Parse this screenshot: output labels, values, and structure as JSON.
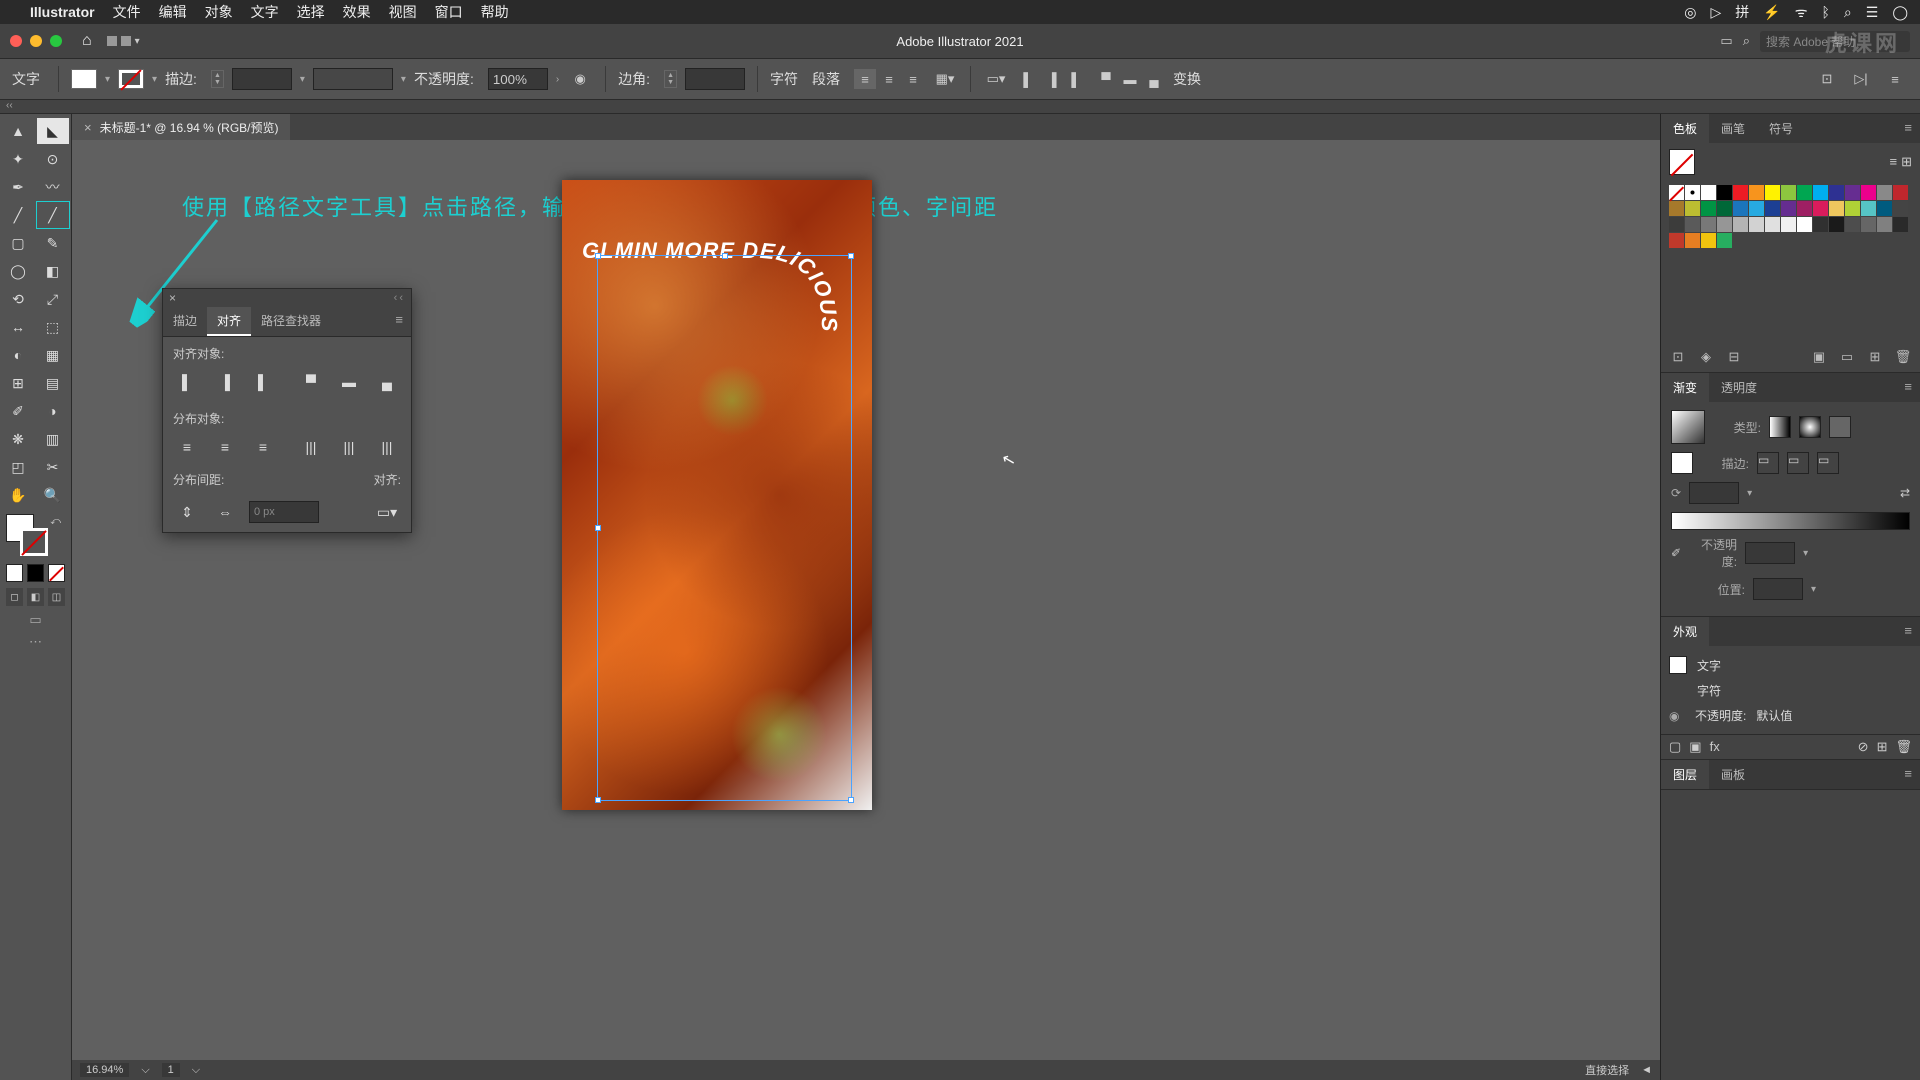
{
  "macos": {
    "app_name": "Illustrator",
    "menus": [
      "文件",
      "编辑",
      "对象",
      "文字",
      "选择",
      "效果",
      "视图",
      "窗口",
      "帮助"
    ]
  },
  "titlebar": {
    "title": "Adobe Illustrator 2021",
    "search_placeholder": "搜索 Adobe 帮助"
  },
  "controlbar": {
    "mode_label": "文字",
    "stroke_label": "描边:",
    "opacity_label": "不透明度:",
    "opacity_value": "100%",
    "corner_label": "边角:",
    "char_label": "字符",
    "para_label": "段落",
    "transform_label": "变换"
  },
  "document": {
    "tab_name": "未标题-1* @ 16.94 % (RGB/预览)",
    "zoom": "16.94%",
    "page": "1",
    "status": "直接选择"
  },
  "annotation": {
    "text": "使用【路径文字工具】点击路径，输入文案，设置合适的字体、颜色、字间距"
  },
  "artwork": {
    "path_text": "GLMIN MORE DELICIOUS"
  },
  "align_panel": {
    "tabs": [
      "描边",
      "对齐",
      "路径查找器"
    ],
    "active_tab": 1,
    "sec_align": "对齐对象:",
    "sec_distribute": "分布对象:",
    "sec_spacing": "分布间距:",
    "align_to": "对齐:",
    "spacing_value": "0 px"
  },
  "swatches": {
    "tabs": [
      "色板",
      "画笔",
      "符号"
    ],
    "colors_row1": [
      "#ffffff",
      "#000000",
      "#ed1c24",
      "#f7941d",
      "#fff200",
      "#8dc63f",
      "#00a651",
      "#00aeef",
      "#2e3192",
      "#662d91",
      "#ec008c",
      "#898989",
      "#c0272d",
      "#a6792b"
    ],
    "colors_row2": [
      "#bcbd31",
      "#009444",
      "#006838",
      "#1b75bc",
      "#27aae1",
      "#1c3f94",
      "#652d90",
      "#9e1f63",
      "#d91c5c",
      "#efc75e",
      "#b0d136",
      "#56c4c5",
      "#005b7f",
      "#444444"
    ],
    "colors_row3": [
      "#3c3c3b",
      "#5a5a5a",
      "#787878",
      "#969696",
      "#b4b4b4",
      "#d2d2d2",
      "#e0e0e0",
      "#f0f0f0",
      "#ffffff",
      "#303030",
      "#1a1a1a",
      "#4d4d4d",
      "#666666",
      "#808080"
    ],
    "colors_row4": [
      "#2a2a2a",
      "#c0392b",
      "#e67e22",
      "#f1c40f",
      "#27ae60"
    ]
  },
  "gradient": {
    "tabs": [
      "渐变",
      "透明度"
    ],
    "type_label": "类型:",
    "stroke_label": "描边:",
    "opacity_label": "不透明度:",
    "position_label": "位置:"
  },
  "appearance": {
    "tab": "外观",
    "obj_type": "文字",
    "char_label": "字符",
    "opacity_label": "不透明度:",
    "opacity_value": "默认值"
  },
  "layers": {
    "tabs": [
      "图层",
      "画板"
    ]
  },
  "watermark": "虎课网"
}
